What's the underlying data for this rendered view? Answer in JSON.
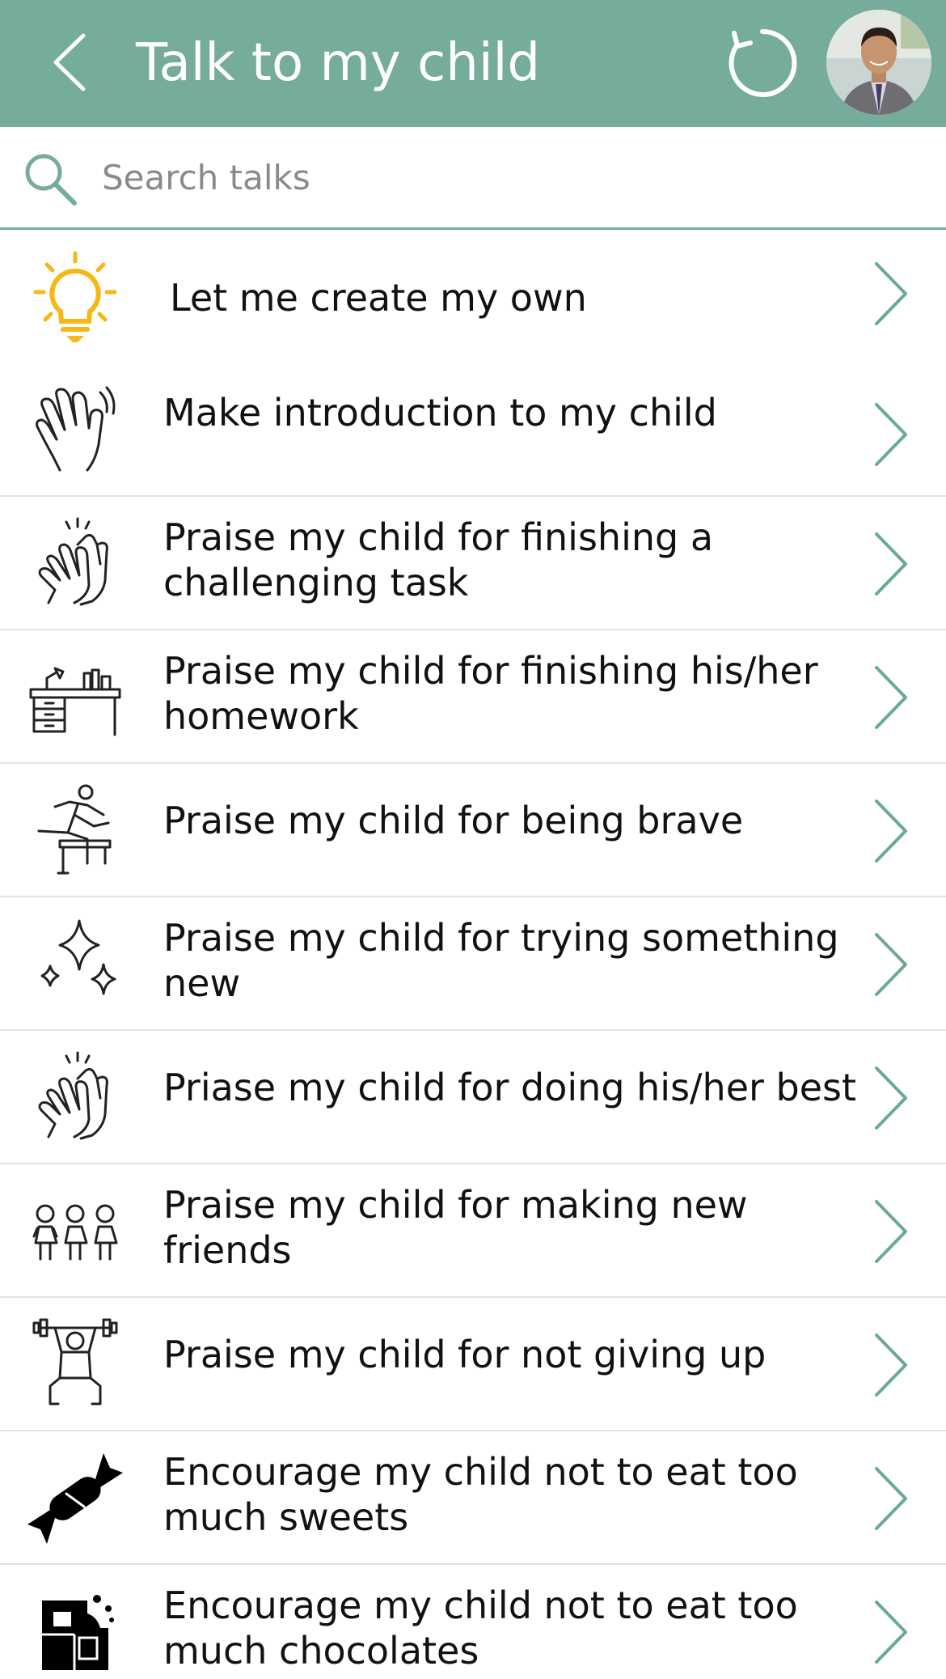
{
  "header": {
    "title": "Talk to my child",
    "back_icon": "chevron-left-icon",
    "refresh_icon": "refresh-icon",
    "background": "#75ac9b"
  },
  "search": {
    "placeholder": "Search talks",
    "value": "",
    "icon": "search-icon"
  },
  "talks": [
    {
      "label": "Let me create my own",
      "icon": "lightbulb-icon"
    },
    {
      "label": "Make introduction to my child",
      "icon": "waving-hand-icon"
    },
    {
      "label": "Praise my child for finishing a challenging task",
      "icon": "clapping-hands-icon"
    },
    {
      "label": "Praise my child for finishing his/her homework",
      "icon": "desk-icon"
    },
    {
      "label": "Praise my child for being brave",
      "icon": "hurdle-runner-icon"
    },
    {
      "label": "Praise my child for trying something new",
      "icon": "sparkles-icon"
    },
    {
      "label": "Priase my child for doing his/her best",
      "icon": "clapping-hands-icon"
    },
    {
      "label": "Praise my child for making new friends",
      "icon": "friends-group-icon"
    },
    {
      "label": "Praise my child for not giving up",
      "icon": "weightlifter-icon"
    },
    {
      "label": "Encourage my child not to eat too much sweets",
      "icon": "candy-icon"
    },
    {
      "label": "Encourage my child not to eat too much chocolates",
      "icon": "chocolate-icon"
    }
  ],
  "colors": {
    "accent": "#75ac9b",
    "chevron": "#6aa996",
    "lightbulb": "#f5b817",
    "divider": "#dce7e4"
  }
}
